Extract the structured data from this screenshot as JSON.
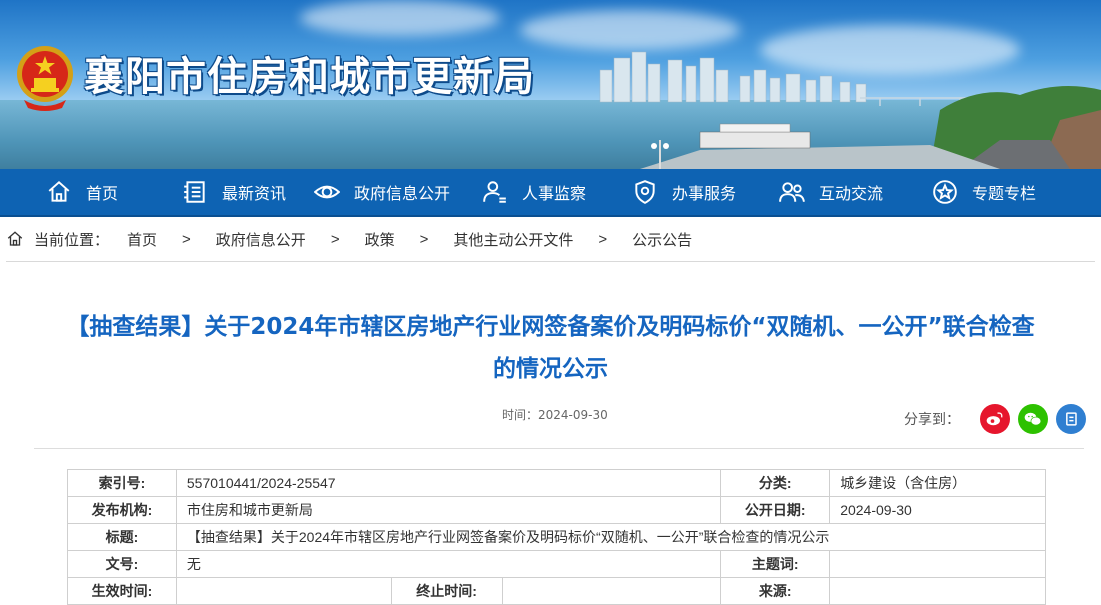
{
  "site": {
    "title": "襄阳市住房和城市更新局"
  },
  "nav": [
    {
      "label": "首页",
      "icon": "home-icon"
    },
    {
      "label": "最新资讯",
      "icon": "news-icon"
    },
    {
      "label": "政府信息公开",
      "icon": "eye-icon"
    },
    {
      "label": "人事监察",
      "icon": "user-icon"
    },
    {
      "label": "办事服务",
      "icon": "shield-icon"
    },
    {
      "label": "互动交流",
      "icon": "people-icon"
    },
    {
      "label": "专题专栏",
      "icon": "star-icon"
    }
  ],
  "breadcrumb": {
    "label": "当前位置：",
    "items": [
      "首页",
      "政府信息公开",
      "政策",
      "其他主动公开文件",
      "公示公告"
    ],
    "separator": ">"
  },
  "article": {
    "title": "【抽查结果】关于2024年市辖区房地产行业网签备案价及明码标价“双随机、一公开”联合检查的情况公示",
    "time": "时间：2024-09-30",
    "share_label": "分享到："
  },
  "info": {
    "index_label": "索引号:",
    "index_value": "557010441/2024-25547",
    "category_label": "分类:",
    "category_value": "城乡建设（含住房）",
    "publisher_label": "发布机构:",
    "publisher_value": "市住房和城市更新局",
    "date_label": "公开日期:",
    "date_value": "2024-09-30",
    "title_label": "标题:",
    "title_value": "【抽查结果】关于2024年市辖区房地产行业网签备案价及明码标价“双随机、一公开”联合检查的情况公示",
    "docno_label": "文号:",
    "docno_value": "无",
    "subject_label": "主题词:",
    "subject_value": "",
    "effective_label": "生效时间:",
    "effective_value": "",
    "expire_label": "终止时间:",
    "expire_value": "",
    "source_label": "来源:",
    "source_value": ""
  },
  "colors": {
    "nav_bg": "#0e63b3",
    "title_blue": "#1565c0",
    "weibo": "#e6162d",
    "wechat": "#2dc100",
    "share_blue": "#2f7fd1"
  }
}
